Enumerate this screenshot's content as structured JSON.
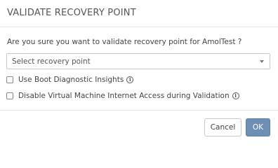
{
  "dialog": {
    "title": "VALIDATE RECOVERY POINT",
    "question": "Are you sure you want to validate recovery point for AmolTest ?",
    "select": {
      "placeholder": "Select recovery point"
    },
    "options": [
      {
        "label": "Use Boot Diagnostic Insights",
        "checked": false,
        "info_icon": "info-icon"
      },
      {
        "label": "Disable Virtual Machine Internet Access during Validation",
        "checked": false,
        "info_icon": "info-icon"
      }
    ],
    "buttons": {
      "cancel": "Cancel",
      "ok": "OK"
    },
    "colors": {
      "primary_button": "#6d8fb5"
    }
  }
}
